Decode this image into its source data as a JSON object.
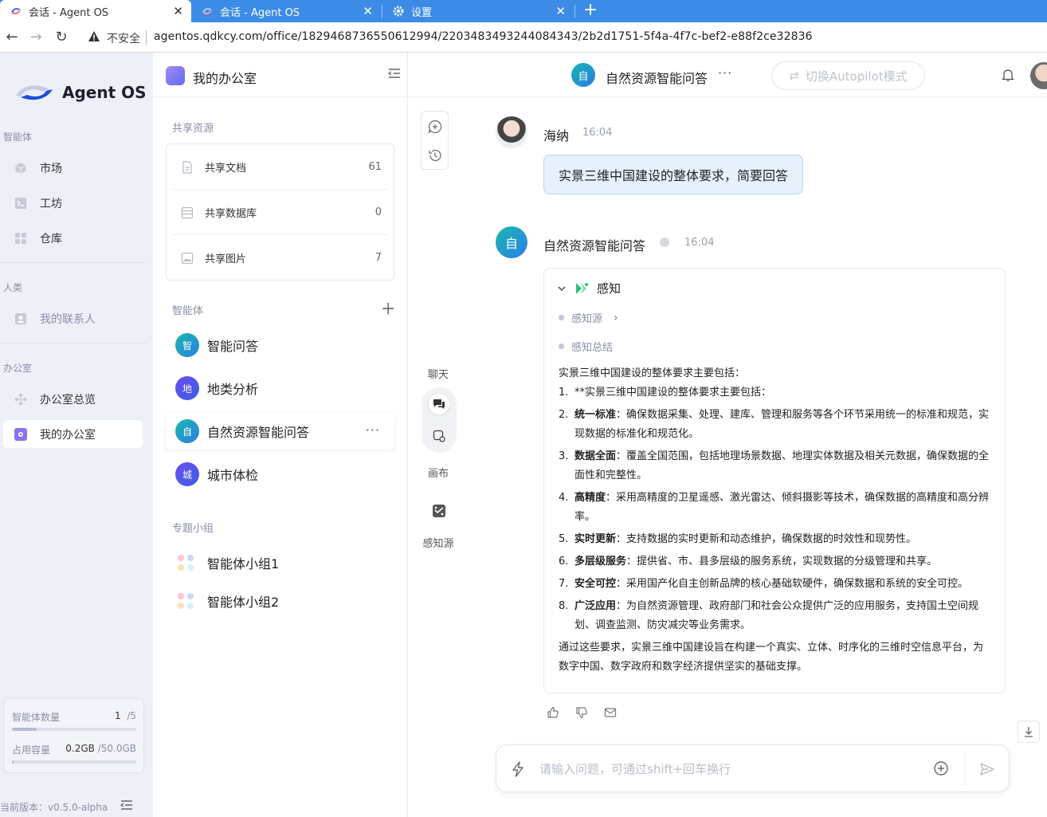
{
  "browser": {
    "tabs": [
      {
        "title": "会话 - Agent OS",
        "active": true
      },
      {
        "title": "会话 - Agent OS",
        "active": false
      },
      {
        "title": "设置",
        "active": false
      }
    ],
    "security_label": "不安全",
    "url": "agentos.qdkcy.com/office/1829468736550612994/2203483493244084343/2b2d1751-5f4a-4f7c-bef2-e88f2ce32836"
  },
  "sidebar": {
    "brand": "Agent OS",
    "sections": {
      "agents": "智能体",
      "humans": "人类",
      "office": "办公室"
    },
    "items": {
      "market": "市场",
      "workshop": "工坊",
      "warehouse": "仓库",
      "contacts": "我的联系人",
      "office_overview": "办公室总览",
      "my_office": "我的办公室"
    },
    "quota": {
      "agents_label": "智能体数量",
      "agents_used": "1",
      "agents_total": "/5",
      "agents_fraction": 0.2,
      "storage_label": "占用容量",
      "storage_used": "0.2GB",
      "storage_total": "/50.0GB",
      "storage_fraction": 0.004
    },
    "version": "当前版本：v0.5.0-alpha"
  },
  "panel": {
    "title": "我的办公室",
    "shared_section": "共享资源",
    "resources": [
      {
        "label": "共享文档",
        "count": "61"
      },
      {
        "label": "共享数据库",
        "count": "0"
      },
      {
        "label": "共享图片",
        "count": "7"
      }
    ],
    "agents_section": "智能体",
    "agents": [
      {
        "badge": "智",
        "name": "智能问答"
      },
      {
        "badge": "地",
        "name": "地类分析"
      },
      {
        "badge": "自",
        "name": "自然资源智能问答"
      },
      {
        "badge": "城",
        "name": "城市体检"
      }
    ],
    "more": "···",
    "groups_section": "专题小组",
    "groups": [
      "智能体小组1",
      "智能体小组2"
    ]
  },
  "main": {
    "header": {
      "avatar": "自",
      "title": "自然资源智能问答",
      "more": "···",
      "autopilot": "切换Autopilot模式"
    },
    "rail": {
      "chat": "聊天",
      "canvas": "画布",
      "sources": "感知源"
    },
    "user_msg": {
      "name": "海纳",
      "time": "16:04",
      "text": "实景三维中国建设的整体要求，简要回答"
    },
    "bot_msg": {
      "avatar": "自",
      "name": "自然资源智能问答",
      "time": "16:04",
      "perception": "感知",
      "perception_source": "感知源",
      "perception_summary": "感知总结",
      "intro": "实景三维中国建设的整体要求主要包括：",
      "points": [
        {
          "num": "1.",
          "bold": "",
          "text": "**实景三维中国建设的整体要求主要包括："
        },
        {
          "num": "2.",
          "bold": "统一标准",
          "text": "：确保数据采集、处理、建库、管理和服务等各个环节采用统一的标准和规范，实现数据的标准化和规范化。"
        },
        {
          "num": "3.",
          "bold": "数据全面",
          "text": "：覆盖全国范围，包括地理场景数据、地理实体数据及相关元数据，确保数据的全面性和完整性。"
        },
        {
          "num": "4.",
          "bold": "高精度",
          "text": "：采用高精度的卫星遥感、激光雷达、倾斜摄影等技术，确保数据的高精度和高分辨率。"
        },
        {
          "num": "5.",
          "bold": "实时更新",
          "text": "：支持数据的实时更新和动态维护，确保数据的时效性和现势性。"
        },
        {
          "num": "6.",
          "bold": "多层级服务",
          "text": "：提供省、市、县多层级的服务系统，实现数据的分级管理和共享。"
        },
        {
          "num": "7.",
          "bold": "安全可控",
          "text": "：采用国产化自主创新品牌的核心基础软硬件，确保数据和系统的安全可控。"
        },
        {
          "num": "8.",
          "bold": "广泛应用",
          "text": "：为自然资源管理、政府部门和社会公众提供广泛的应用服务，支持国土空间规划、调查监测、防灾减灾等业务需求。"
        }
      ],
      "conclusion": "通过这些要求，实景三维中国建设旨在构建一个真实、立体、时序化的三维时空信息平台，为数字中国、数字政府和数字经济提供坚实的基础支撑。"
    },
    "input": {
      "placeholder": "请输入问题，可通过shift+回车换行",
      "value": ""
    }
  }
}
